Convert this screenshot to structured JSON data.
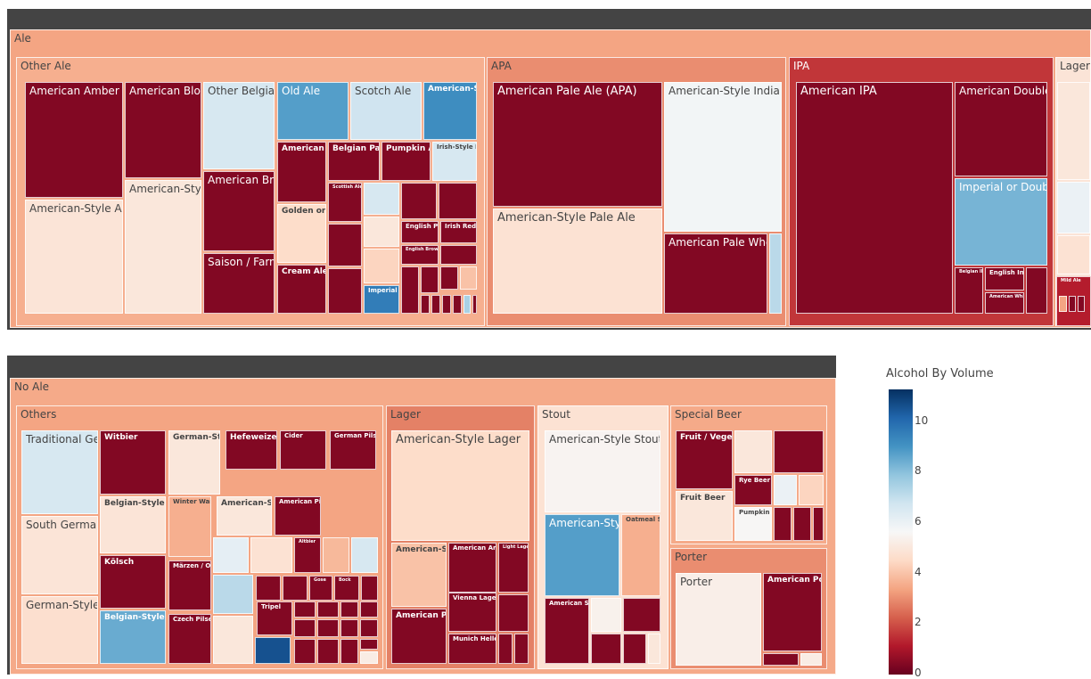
{
  "chart_data": [
    {
      "type": "treemap",
      "title": "",
      "color_metric": "Alcohol By Volume",
      "root": {
        "name": "Ale",
        "abv": 3.4,
        "children": [
          {
            "name": "Other Ale",
            "abv": 3.6,
            "children": [
              {
                "name": "American Amber / Red Ale",
                "abv": 0.4
              },
              {
                "name": "American-Style Amber/Red Ale",
                "abv": 4.9
              },
              {
                "name": "American Blonde Ale",
                "abv": 0.4
              },
              {
                "name": "American-Style Brown Ale",
                "abv": 5.0
              },
              {
                "name": "Other Belgian-Style Ales",
                "abv": 6.6
              },
              {
                "name": "American Brown Ale",
                "abv": 0.4
              },
              {
                "name": "Saison / Farmhouse Ale",
                "abv": 0.4
              },
              {
                "name": "Old Ale",
                "abv": 8.8
              },
              {
                "name": "American Black Ale",
                "abv": 0.4
              },
              {
                "name": "Golden or Blonde Ale",
                "abv": 4.6
              },
              {
                "name": "Cream Ale",
                "abv": 0.4
              },
              {
                "name": "Scotch Ale",
                "abv": 6.8
              },
              {
                "name": "American-Style Barley Wine Ale",
                "abv": 9.2
              },
              {
                "name": "Belgian Pale Ale",
                "abv": 0.4
              },
              {
                "name": "Pumpkin Ale",
                "abv": 0.4
              },
              {
                "name": "Irish-Style Red Ale",
                "abv": 6.6
              },
              {
                "name": "Scottish Ale",
                "abv": 0.4
              },
              {
                "name": "English Pale Ale",
                "abv": 0.4
              },
              {
                "name": "Irish Red Ale",
                "abv": 0.4
              },
              {
                "name": "English Brown Ale",
                "abv": 0.4
              },
              {
                "name": "Imperial Stout",
                "abv": 9.6
              }
            ]
          },
          {
            "name": "APA",
            "abv": 3.0,
            "children": [
              {
                "name": "American Pale Ale (APA)",
                "abv": 0.4
              },
              {
                "name": "American-Style Pale Ale",
                "abv": 4.8
              },
              {
                "name": "American-Style India Pale Ale",
                "abv": 5.8
              },
              {
                "name": "American Pale Wheat Ale",
                "abv": 0.4
              }
            ]
          },
          {
            "name": "IPA",
            "abv": 1.6,
            "children": [
              {
                "name": "American IPA",
                "abv": 0.4
              },
              {
                "name": "American Double / Imperial IPA",
                "abv": 0.4
              },
              {
                "name": "Imperial or Double India Pale Ale",
                "abv": 8.3
              },
              {
                "name": "Belgian IPA",
                "abv": 0.4
              },
              {
                "name": "English India Pale Ale (IPA)",
                "abv": 0.4
              },
              {
                "name": "American White IPA",
                "abv": 0.4
              }
            ]
          },
          {
            "name": "Lager",
            "abv": 4.9,
            "children": [
              {
                "name": "Mild Ale",
                "abv": 1.2
              }
            ]
          }
        ]
      }
    },
    {
      "type": "treemap",
      "title": "",
      "color_metric": "Alcohol By Volume",
      "root": {
        "name": "No Ale",
        "abv": 3.5,
        "children": [
          {
            "name": "Others",
            "abv": 3.4,
            "children": [
              {
                "name": "Traditional German-Style Bock",
                "abv": 6.6
              },
              {
                "name": "South German-Style Hefeweizen",
                "abv": 4.9
              },
              {
                "name": "German-Style Pilsener",
                "abv": 4.7
              },
              {
                "name": "Witbier",
                "abv": 0.4
              },
              {
                "name": "Belgian-Style White",
                "abv": 4.9
              },
              {
                "name": "Kölsch",
                "abv": 0.4
              },
              {
                "name": "Belgian-Style Tripel",
                "abv": 8.5
              },
              {
                "name": "German-Style Heller Bock/Maibock",
                "abv": 5.0
              },
              {
                "name": "Winter Warmer",
                "abv": 3.6
              },
              {
                "name": "Märzen / Oktoberfest",
                "abv": 0.4
              },
              {
                "name": "Czech Pilsener",
                "abv": 0.4
              },
              {
                "name": "Hefeweizen",
                "abv": 0.4
              },
              {
                "name": "American-Style Wheat Beer",
                "abv": 5.0
              },
              {
                "name": "Cider",
                "abv": 0.4
              },
              {
                "name": "American Pilsner",
                "abv": 0.4
              },
              {
                "name": "German Pilsener",
                "abv": 0.4
              },
              {
                "name": "Altbier",
                "abv": 0.4
              },
              {
                "name": "Gose",
                "abv": 0.4
              },
              {
                "name": "Bock",
                "abv": 0.4
              },
              {
                "name": "Tripel",
                "abv": 0.4
              }
            ]
          },
          {
            "name": "Lager",
            "abv": 2.8,
            "children": [
              {
                "name": "American-Style Lager",
                "abv": 4.6
              },
              {
                "name": "American-Style Light Lager",
                "abv": 4.0
              },
              {
                "name": "American Pale Lager",
                "abv": 0.4
              },
              {
                "name": "American Amber / Red Lager",
                "abv": 0.4
              },
              {
                "name": "Vienna Lager",
                "abv": 0.4
              },
              {
                "name": "Light Lager",
                "abv": 0.4
              },
              {
                "name": "Munich Helles Lager",
                "abv": 0.4
              }
            ]
          },
          {
            "name": "Stout",
            "abv": 4.8,
            "children": [
              {
                "name": "American-Style Stout",
                "abv": 5.5
              },
              {
                "name": "American-Style Imperial Stout",
                "abv": 8.8
              },
              {
                "name": "Oatmeal Stout",
                "abv": 3.6
              },
              {
                "name": "American Stout",
                "abv": 0.4
              }
            ]
          },
          {
            "name": "Special Beer",
            "abv": 3.5,
            "children": [
              {
                "name": "Fruit / Vegetable Beer",
                "abv": 0.4
              },
              {
                "name": "Fruit Beer",
                "abv": 5.0
              },
              {
                "name": "Rye Beer",
                "abv": 0.4
              },
              {
                "name": "Pumpkin Beer",
                "abv": 5.6
              }
            ]
          },
          {
            "name": "Porter",
            "abv": 3.0,
            "children": [
              {
                "name": "Porter",
                "abv": 5.3
              },
              {
                "name": "American Porter",
                "abv": 0.4
              }
            ]
          }
        ]
      }
    }
  ],
  "colorbar": {
    "title": "Alcohol By Volume",
    "min": 0,
    "max": 11.3,
    "ticks": [
      "0",
      "2",
      "4",
      "6",
      "8",
      "10"
    ],
    "colorscale": [
      "#67001f",
      "#b2182b",
      "#d6604d",
      "#f4a582",
      "#fddbc7",
      "#f7f7f7",
      "#d1e5f0",
      "#92c5de",
      "#4393c3",
      "#2166ac",
      "#053061"
    ]
  }
}
